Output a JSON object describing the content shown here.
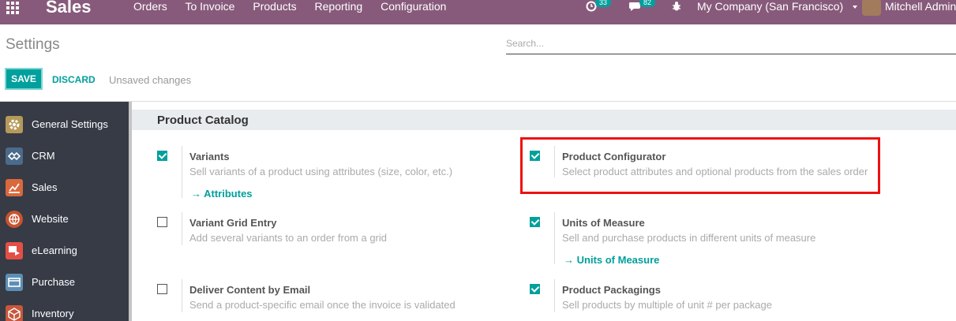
{
  "navbar": {
    "app_name": "Sales",
    "menu": [
      "Orders",
      "To Invoice",
      "Products",
      "Reporting",
      "Configuration"
    ],
    "activity_count": "33",
    "messages_count": "82",
    "company": "My Company (San Francisco)",
    "user": "Mitchell Admin",
    "color": "#875a7b"
  },
  "control_panel": {
    "title": "Settings",
    "search_placeholder": "Search...",
    "save_label": "SAVE",
    "discard_label": "DISCARD",
    "status": "Unsaved changes"
  },
  "sidebar": {
    "items": [
      {
        "label": "General Settings",
        "icon": "gear-icon"
      },
      {
        "label": "CRM",
        "icon": "crm-handshake-icon"
      },
      {
        "label": "Sales",
        "icon": "sales-chart-icon"
      },
      {
        "label": "Website",
        "icon": "globe-icon"
      },
      {
        "label": "eLearning",
        "icon": "elearning-icon"
      },
      {
        "label": "Purchase",
        "icon": "purchase-icon"
      },
      {
        "label": "Inventory",
        "icon": "inventory-box-icon"
      }
    ]
  },
  "section": {
    "title": "Product Catalog",
    "settings": [
      {
        "title": "Variants",
        "description": "Sell variants of a product using attributes (size, color, etc.)",
        "checked": true,
        "link": "Attributes"
      },
      {
        "title": "Product Configurator",
        "description": "Select product attributes and optional products from the sales order",
        "checked": true
      },
      {
        "title": "Variant Grid Entry",
        "description": "Add several variants to an order from a grid",
        "checked": false
      },
      {
        "title": "Units of Measure",
        "description": "Sell and purchase products in different units of measure",
        "checked": true,
        "link": "Units of Measure"
      },
      {
        "title": "Deliver Content by Email",
        "description": "Send a product-specific email once the invoice is validated",
        "checked": false
      },
      {
        "title": "Product Packagings",
        "description": "Sell products by multiple of unit # per package",
        "checked": true
      }
    ]
  },
  "colors": {
    "accent": "#00a09d",
    "highlight": "#e11111"
  }
}
